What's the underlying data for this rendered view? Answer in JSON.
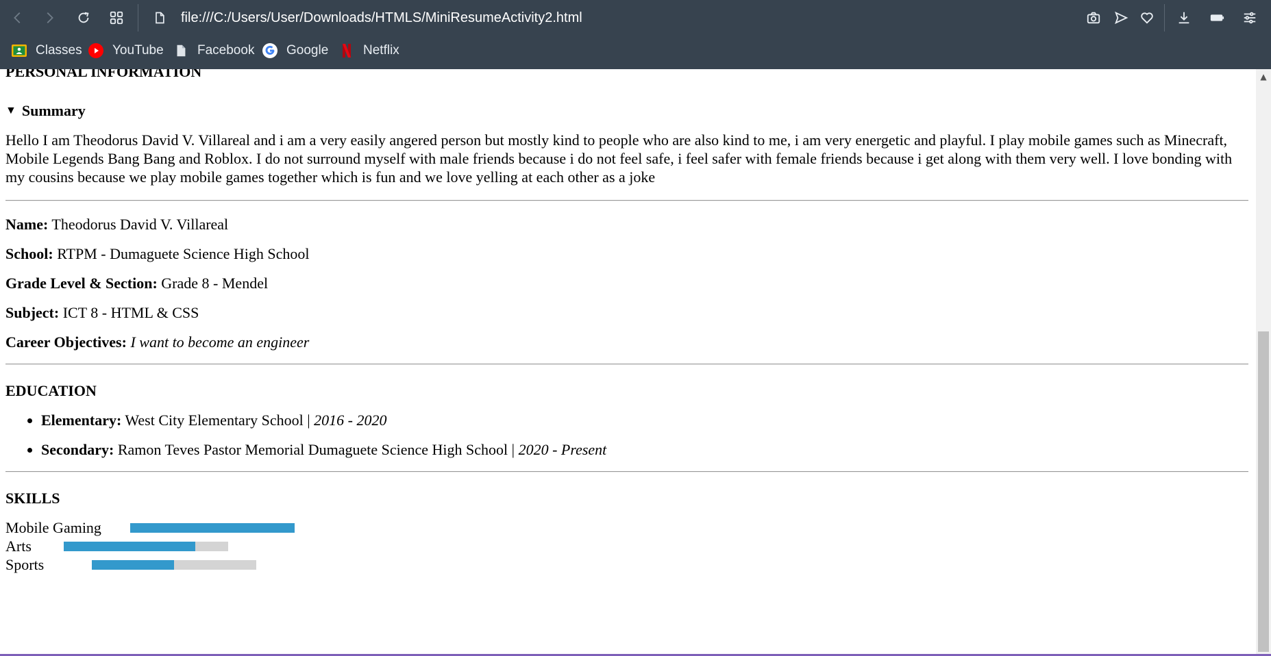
{
  "browser": {
    "url": "file:///C:/Users/User/Downloads/HTMLS/MiniResumeActivity2.html",
    "bookmarks": [
      {
        "label": "Classes",
        "icon": "google-classroom-icon",
        "color": "#f4b400"
      },
      {
        "label": "YouTube",
        "icon": "youtube-icon",
        "color": "#ff0000"
      },
      {
        "label": "Facebook",
        "icon": "document-icon",
        "color": "#dfe4e9"
      },
      {
        "label": "Google",
        "icon": "google-icon",
        "color": "#4285f4"
      },
      {
        "label": "Netflix",
        "icon": "netflix-icon",
        "color": "#e50914"
      }
    ],
    "toolbar_icons": [
      "back-icon",
      "forward-icon",
      "reload-icon",
      "tab-grid-icon",
      "page-icon",
      "camera-icon",
      "send-icon",
      "heart-icon",
      "download-icon",
      "battery-icon",
      "settings-sliders-icon"
    ]
  },
  "resume": {
    "heading_personal": "PERSONAL INFORMATION",
    "summary_toggle": "▼",
    "summary_label": "Summary",
    "summary_text": "Hello I am Theodorus David V. Villareal and i am a very easily angered person but mostly kind to people who are also kind to me, i am very energetic and playful. I play mobile games such as Minecraft, Mobile Legends Bang Bang and Roblox. I do not surround myself with male friends because i do not feel safe, i feel safer with female friends because i get along with them very well. I love bonding with my cousins because we play mobile games together which is fun and we love yelling at each other as a joke",
    "fields": [
      {
        "label": "Name:",
        "value": "Theodorus David V. Villareal"
      },
      {
        "label": "School:",
        "value": "RTPM - Dumaguete Science High School"
      },
      {
        "label": "Grade Level & Section:",
        "value": "Grade 8 - Mendel"
      },
      {
        "label": "Subject:",
        "value": "ICT 8 - HTML & CSS"
      },
      {
        "label": "Career Objectives:",
        "value": "I want to become an engineer"
      }
    ],
    "heading_education": "EDUCATION",
    "education": [
      {
        "label": "Elementary:",
        "school": "West City Elementary School",
        "sep": "|",
        "start": "2016",
        "dash": "-",
        "end": "2020"
      },
      {
        "label": "Secondary:",
        "school": "Ramon Teves Pastor Memorial Dumaguete Science High School",
        "sep": "|",
        "start": "2020",
        "dash": "-",
        "end": "Present"
      }
    ],
    "heading_skills": "SKILLS",
    "skills": [
      {
        "name": "Mobile Gaming",
        "level": 1.0
      },
      {
        "name": "Arts",
        "level": 0.8
      },
      {
        "name": "Sports",
        "level": 0.5
      }
    ]
  },
  "colors": {
    "chrome": "#37434f",
    "skill_fill": "#3399cc",
    "skill_track": "#d4d4d4"
  }
}
